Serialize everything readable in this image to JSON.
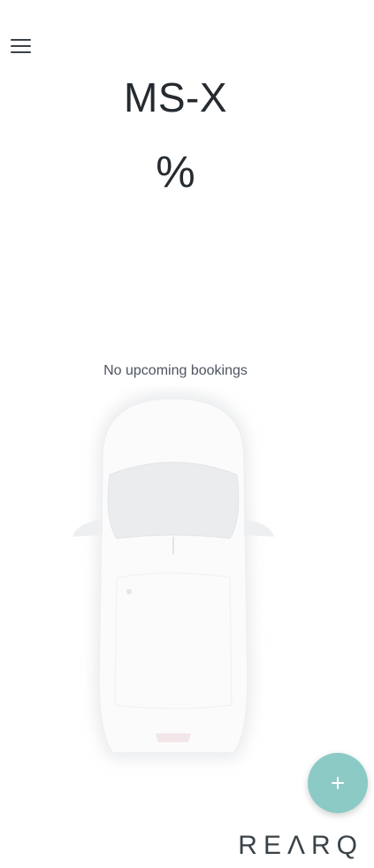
{
  "header": {
    "menu_icon": "hamburger-menu-icon"
  },
  "vehicle": {
    "name": "MS-X",
    "battery_level": "%"
  },
  "bookings": {
    "status": "No upcoming bookings"
  },
  "actions": {
    "add_icon": "plus-icon"
  },
  "brand": {
    "logo_text": "REΛRQ"
  },
  "colors": {
    "accent": "#8ccac6",
    "text_dark": "#252b30",
    "text_muted": "#4c5560"
  }
}
